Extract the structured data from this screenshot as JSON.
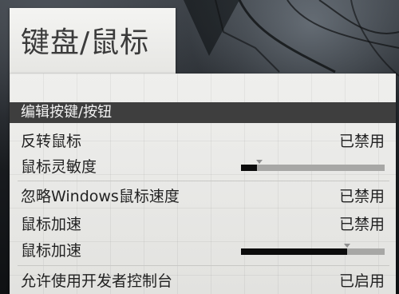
{
  "page": {
    "title": "键盘/鼠标"
  },
  "section": {
    "header": "编辑按键/按钮"
  },
  "settings": {
    "invert_mouse": {
      "label": "反转鼠标",
      "value": "已禁用"
    },
    "mouse_sensitivity": {
      "label": "鼠标灵敏度",
      "level": 0.11,
      "marker": 0.13
    },
    "ignore_windows_mouse_speed": {
      "label": "忽略Windows鼠标速度",
      "value": "已禁用"
    },
    "mouse_acceleration": {
      "label": "鼠标加速",
      "value": "已禁用"
    },
    "mouse_acceleration_amount": {
      "label": "鼠标加速",
      "level": 0.74,
      "marker": 0.74
    },
    "developer_console": {
      "label": "允许使用开发者控制台",
      "value": "已启用"
    }
  },
  "colors": {
    "panel": "#ececea",
    "header_bg": "#3e3e3e",
    "header_text": "#f2f2f2",
    "text": "#222222",
    "slider_track": "#a7a7a5",
    "slider_fill": "#0c0c0c"
  }
}
